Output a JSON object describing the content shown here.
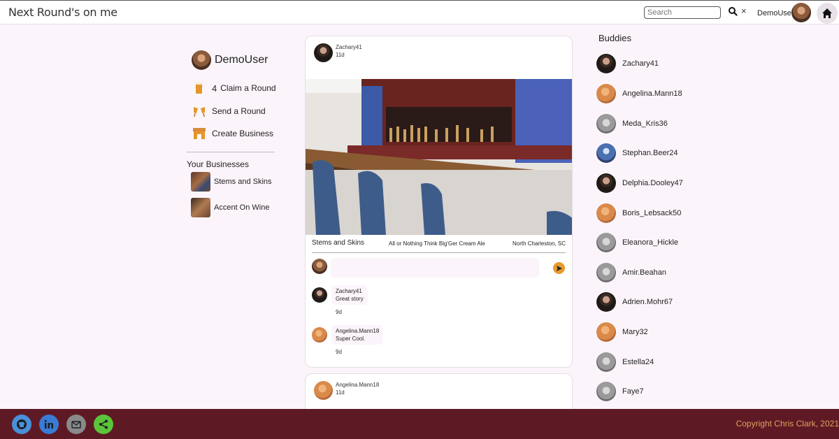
{
  "header": {
    "brand": "Next Round's on me",
    "search_placeholder": "Search",
    "clear_label": "×",
    "username": "DemoUser"
  },
  "sidebar": {
    "username": "DemoUser",
    "claim_count": "4",
    "menu": [
      {
        "label": "Claim a Round",
        "icon": "beer-icon"
      },
      {
        "label": "Send a Round",
        "icon": "cheers-icon"
      },
      {
        "label": "Create Business",
        "icon": "store-icon"
      }
    ],
    "businesses_title": "Your Businesses",
    "businesses": [
      {
        "label": "Stems and Skins"
      },
      {
        "label": "Accent On Wine"
      }
    ]
  },
  "posts": [
    {
      "author": "Zachary41",
      "age": "11d",
      "business": "Stems and Skins",
      "item": "All or Nothing Think Big'Ger Cream Ale",
      "location": "North Charleston, SC",
      "comments": [
        {
          "author": "Zachary41",
          "text": "Great story",
          "age": "9d"
        },
        {
          "author": "Angelina.Mann18",
          "text": "Super Cool.",
          "age": "9d"
        }
      ]
    },
    {
      "author": "Angelina.Mann18",
      "age": "11d"
    }
  ],
  "buddies": {
    "title": "Buddies",
    "list": [
      {
        "name": "Zachary41"
      },
      {
        "name": "Angelina.Mann18"
      },
      {
        "name": "Meda_Kris36"
      },
      {
        "name": "Stephan.Beer24"
      },
      {
        "name": "Delphia.Dooley47"
      },
      {
        "name": "Boris_Lebsack50"
      },
      {
        "name": "Eleanora_Hickle"
      },
      {
        "name": "Amir.Beahan"
      },
      {
        "name": "Adrien.Mohr67"
      },
      {
        "name": "Mary32"
      },
      {
        "name": "Estella24"
      },
      {
        "name": "Faye7"
      }
    ]
  },
  "footer": {
    "copyright": "Copyright Chris Clark, 2021",
    "links": [
      {
        "icon": "github-icon",
        "color": "#4a90d9"
      },
      {
        "icon": "linkedin-icon",
        "color": "#3a7bd5"
      },
      {
        "icon": "mail-icon",
        "color": "#8a8a8a"
      },
      {
        "icon": "share-icon",
        "color": "#5cc43a"
      }
    ]
  },
  "colors": {
    "accent": "#e69a30",
    "footer_bg": "#5e1a24",
    "page_bg": "#fbf5fb"
  }
}
